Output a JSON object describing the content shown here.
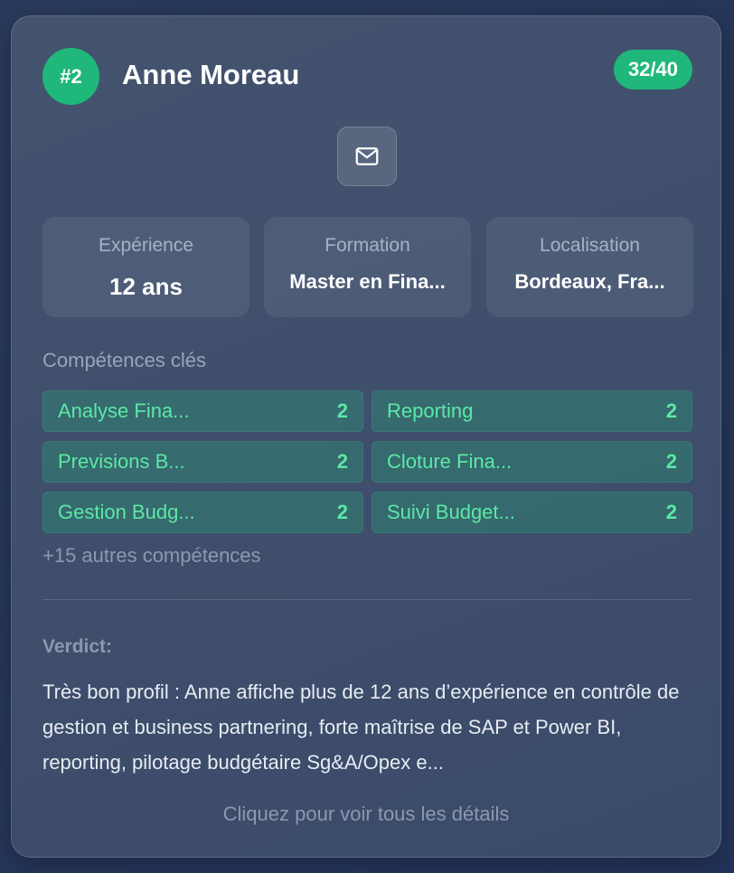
{
  "candidate": {
    "rank": "#2",
    "name": "Anne Moreau",
    "score": "32/40"
  },
  "contact": {
    "icon": "mail-icon"
  },
  "info": [
    {
      "label": "Expérience",
      "value": "12 ans"
    },
    {
      "label": "Formation",
      "value": "Master en Fina..."
    },
    {
      "label": "Localisation",
      "value": "Bordeaux, Fra..."
    }
  ],
  "skills": {
    "title": "Compétences clés",
    "items": [
      {
        "name": "Analyse Fina...",
        "count": "2"
      },
      {
        "name": "Reporting",
        "count": "2"
      },
      {
        "name": "Previsions B...",
        "count": "2"
      },
      {
        "name": "Cloture Fina...",
        "count": "2"
      },
      {
        "name": "Gestion Budg...",
        "count": "2"
      },
      {
        "name": "Suivi Budget...",
        "count": "2"
      }
    ],
    "more": "+15 autres compétences"
  },
  "verdict": {
    "label": "Verdict:",
    "text": "Très bon profil : Anne affiche plus de 12 ans d’expérience en contrôle de gestion et business partnering, forte maîtrise de SAP et Power BI, reporting, pilotage budgétaire Sg&A/Opex e..."
  },
  "footer": {
    "hint": "Cliquez pour voir tous les détails"
  },
  "colors": {
    "accent": "#1fb87a",
    "skill_text": "#5ce8a6",
    "card_bg": "#3f4f6c"
  }
}
